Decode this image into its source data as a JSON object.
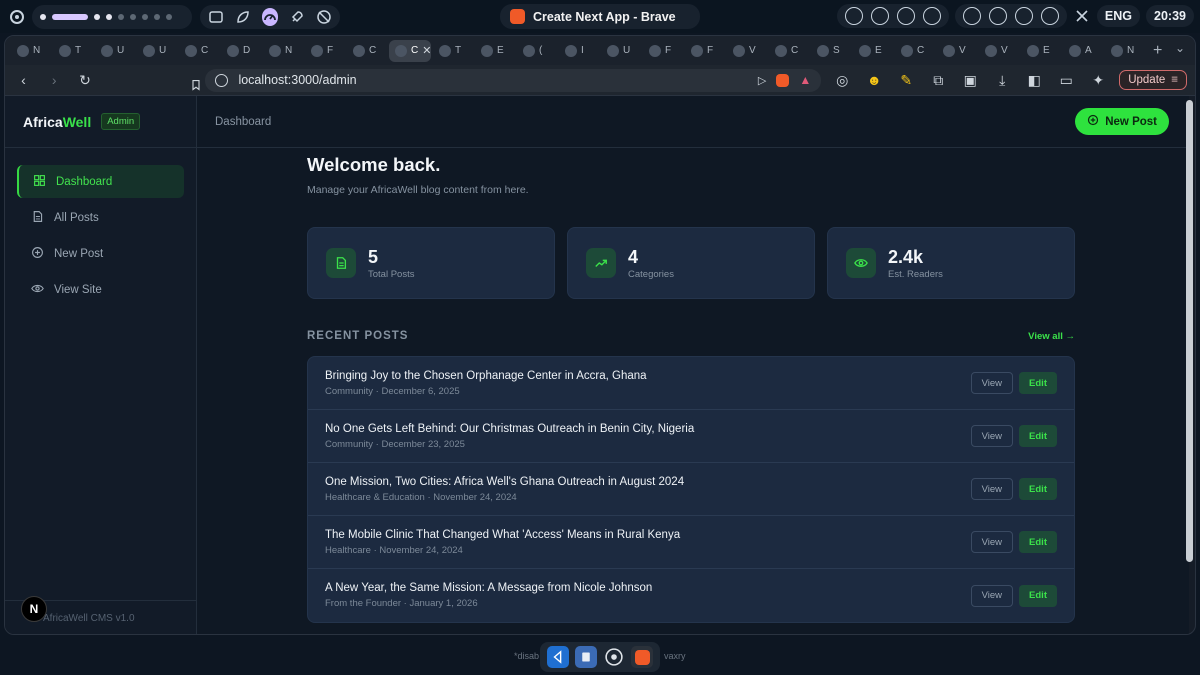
{
  "os": {
    "window_title": "Create Next App - Brave",
    "language": "ENG",
    "time": "20:39"
  },
  "browser": {
    "url": "localhost:3000/admin",
    "update_label": "Update",
    "tabs": [
      {
        "label": "N"
      },
      {
        "label": "T"
      },
      {
        "label": "U"
      },
      {
        "label": "U"
      },
      {
        "label": "C"
      },
      {
        "label": "D"
      },
      {
        "label": "N"
      },
      {
        "label": "F"
      },
      {
        "label": "C"
      },
      {
        "label": "C",
        "active": true
      },
      {
        "label": "T"
      },
      {
        "label": "E"
      },
      {
        "label": "("
      },
      {
        "label": "I"
      },
      {
        "label": "U"
      },
      {
        "label": "F"
      },
      {
        "label": "F"
      },
      {
        "label": "V"
      },
      {
        "label": "C"
      },
      {
        "label": "S"
      },
      {
        "label": "E"
      },
      {
        "label": "C"
      },
      {
        "label": "V"
      },
      {
        "label": "V"
      },
      {
        "label": "E"
      },
      {
        "label": "A"
      },
      {
        "label": "N"
      }
    ]
  },
  "sidebar": {
    "brand_main": "Africa",
    "brand_accent": "Well",
    "badge": "Admin",
    "items": [
      {
        "label": "Dashboard",
        "icon": "grid-icon",
        "active": true
      },
      {
        "label": "All Posts",
        "icon": "document-icon"
      },
      {
        "label": "New Post",
        "icon": "plus-circle-icon"
      },
      {
        "label": "View Site",
        "icon": "eye-icon"
      }
    ],
    "footer": "AfricaWell CMS v1.0",
    "next_badge": "N"
  },
  "header": {
    "breadcrumb": "Dashboard",
    "new_post_label": "New Post"
  },
  "main": {
    "welcome": "Welcome back.",
    "subtitle": "Manage your AfricaWell blog content from here.",
    "stats": [
      {
        "value": "5",
        "label": "Total Posts",
        "icon": "document-icon"
      },
      {
        "value": "4",
        "label": "Categories",
        "icon": "trending-up-icon"
      },
      {
        "value": "2.4k",
        "label": "Est. Readers",
        "icon": "eye-icon"
      }
    ],
    "recent_title": "RECENT POSTS",
    "view_all": "View all →",
    "view_label": "View",
    "edit_label": "Edit",
    "posts": [
      {
        "title": "Bringing Joy to the Chosen Orphanage Center in Accra, Ghana",
        "meta": "Community · December 6, 2025"
      },
      {
        "title": "No One Gets Left Behind: Our Christmas Outreach in Benin City, Nigeria",
        "meta": "Community · December 23, 2025"
      },
      {
        "title": "One Mission, Two Cities: Africa Well's Ghana Outreach in August 2024",
        "meta": "Healthcare & Education · November 24, 2024"
      },
      {
        "title": "The Mobile Clinic That Changed What 'Access' Means in Rural Kenya",
        "meta": "Healthcare · November 24, 2024"
      },
      {
        "title": "A New Year, the Same Mission: A Message from Nicole Johnson",
        "meta": "From the Founder · January 1, 2026"
      }
    ]
  },
  "dock": {
    "left_text": "*disab",
    "right_text": "vaxry"
  },
  "colors": {
    "accent": "#2ee23e",
    "card": "#1c2a40",
    "sidebar": "#121b28"
  }
}
